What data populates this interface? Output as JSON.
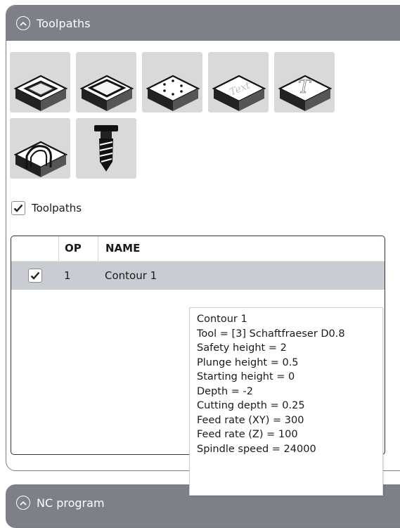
{
  "toolpaths_panel": {
    "title": "Toolpaths",
    "tool_buttons": [
      {
        "icon": "pocket-icon"
      },
      {
        "icon": "contour-icon"
      },
      {
        "icon": "drill-points-icon"
      },
      {
        "icon": "text-engrave-icon",
        "glyph": "Text"
      },
      {
        "icon": "text-t-icon",
        "glyph": "T"
      },
      {
        "icon": "slot-arch-icon"
      },
      {
        "icon": "drill-bit-icon"
      }
    ],
    "show_toolpaths_label": "Toolpaths",
    "show_toolpaths_checked": true
  },
  "grid": {
    "headers": {
      "op": "OP",
      "name": "NAME"
    },
    "rows": [
      {
        "checked": true,
        "op": "1",
        "name": "Contour 1"
      }
    ]
  },
  "tooltip": {
    "lines": [
      "Contour 1",
      "Tool = [3] Schaftfraeser D0.8",
      "Safety height = 2",
      "Plunge height = 0.5",
      "Starting height = 0",
      "Depth = -2",
      "Cutting depth = 0.25",
      "Feed rate (XY) = 300",
      "Feed rate (Z) = 100",
      "Spindle speed = 24000"
    ]
  },
  "nc_panel": {
    "title": "NC program"
  },
  "colors": {
    "header_bg": "#7d8088",
    "selected_row": "#c9ccd2",
    "tool_button_bg": "#d9d9d9"
  }
}
